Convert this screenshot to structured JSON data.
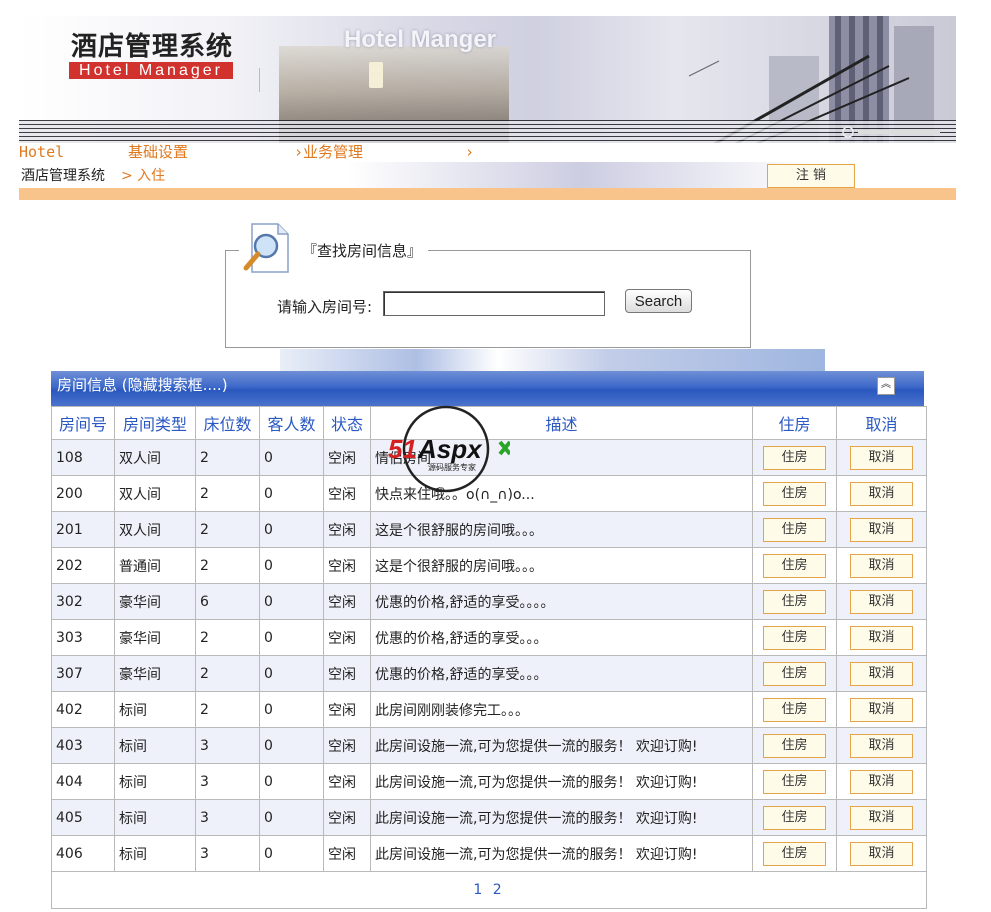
{
  "banner": {
    "logo_cn": "酒店管理系统",
    "logo_en": "Hotel Manager",
    "title_en": "Hotel Manger"
  },
  "menu": {
    "items": [
      "Hotel",
      "基础设置",
      "›业务管理",
      "›"
    ]
  },
  "breadcrumb": {
    "home": "酒店管理系统",
    "current": "> 入住"
  },
  "logout_label": "注 销",
  "search": {
    "legend": "『查找房间信息』",
    "label": "请输入房间号:",
    "value": "",
    "button": "Search"
  },
  "panel": {
    "title": "房间信息 (隐藏搜索框....)",
    "collapse_icon": "double-chevron-up-icon"
  },
  "table": {
    "headers": [
      "房间号",
      "房间类型",
      "床位数",
      "客人数",
      "状态",
      "描述",
      "住房",
      "取消"
    ],
    "checkin_label": "住房",
    "cancel_label": "取消",
    "rows": [
      {
        "room": "108",
        "type": "双人间",
        "beds": "2",
        "guests": "0",
        "status": "空闲",
        "desc": "情侣房间"
      },
      {
        "room": "200",
        "type": "双人间",
        "beds": "2",
        "guests": "0",
        "status": "空闲",
        "desc": "快点来住哦。。o(∩_∩)o..."
      },
      {
        "room": "201",
        "type": "双人间",
        "beds": "2",
        "guests": "0",
        "status": "空闲",
        "desc": "这是个很舒服的房间哦。。。"
      },
      {
        "room": "202",
        "type": "普通间",
        "beds": "2",
        "guests": "0",
        "status": "空闲",
        "desc": "这是个很舒服的房间哦。。。"
      },
      {
        "room": "302",
        "type": "豪华间",
        "beds": "6",
        "guests": "0",
        "status": "空闲",
        "desc": "优惠的价格,舒适的享受。。。。"
      },
      {
        "room": "303",
        "type": "豪华间",
        "beds": "2",
        "guests": "0",
        "status": "空闲",
        "desc": "优惠的价格,舒适的享受。。。"
      },
      {
        "room": "307",
        "type": "豪华间",
        "beds": "2",
        "guests": "0",
        "status": "空闲",
        "desc": "优惠的价格,舒适的享受。。。"
      },
      {
        "room": "402",
        "type": "标间",
        "beds": "2",
        "guests": "0",
        "status": "空闲",
        "desc": "此房间刚刚装修完工。。。"
      },
      {
        "room": "403",
        "type": "标间",
        "beds": "3",
        "guests": "0",
        "status": "空闲",
        "desc": "此房间设施一流,可为您提供一流的服务！ 欢迎订购!"
      },
      {
        "room": "404",
        "type": "标间",
        "beds": "3",
        "guests": "0",
        "status": "空闲",
        "desc": "此房间设施一流,可为您提供一流的服务！ 欢迎订购!"
      },
      {
        "room": "405",
        "type": "标间",
        "beds": "3",
        "guests": "0",
        "status": "空闲",
        "desc": "此房间设施一流,可为您提供一流的服务！ 欢迎订购!"
      },
      {
        "room": "406",
        "type": "标间",
        "beds": "3",
        "guests": "0",
        "status": "空闲",
        "desc": "此房间设施一流,可为您提供一流的服务！ 欢迎订购!"
      }
    ],
    "pager": "1 2"
  },
  "watermark": {
    "brand": "51Aspx",
    "tagline": "源码服务专家"
  },
  "colors": {
    "accent_orange": "#e07a20",
    "header_blue": "#2b59c3",
    "button_border": "#e6a44a"
  }
}
